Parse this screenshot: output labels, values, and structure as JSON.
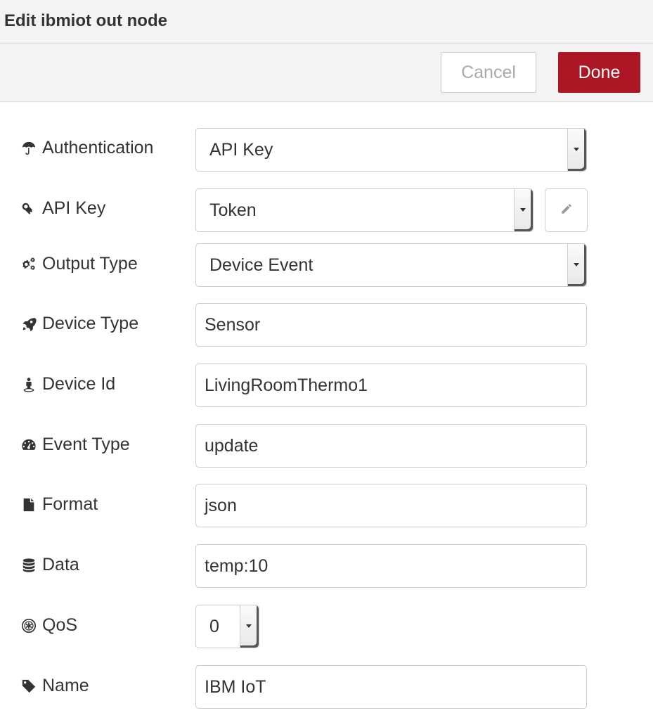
{
  "dialog": {
    "title": "Edit ibmiot out node",
    "cancel_label": "Cancel",
    "done_label": "Done",
    "accent_color": "#ad1625"
  },
  "form": {
    "authentication": {
      "label": "Authentication",
      "value": "API Key",
      "icon": "umbrella-icon"
    },
    "api_key": {
      "label": "API Key",
      "value": "Token",
      "icon": "key-icon",
      "edit_icon": "pencil-icon"
    },
    "output_type": {
      "label": "Output Type",
      "value": "Device Event",
      "icon": "cogs-icon"
    },
    "device_type": {
      "label": "Device Type",
      "value": "Sensor",
      "icon": "rocket-icon"
    },
    "device_id": {
      "label": "Device Id",
      "value": "LivingRoomThermo1",
      "icon": "street-view-icon"
    },
    "event_type": {
      "label": "Event Type",
      "value": "update",
      "icon": "dashboard-icon"
    },
    "format": {
      "label": "Format",
      "value": "json",
      "icon": "file-icon"
    },
    "data": {
      "label": "Data",
      "value": "temp:10",
      "icon": "database-icon"
    },
    "qos": {
      "label": "QoS",
      "value": "0",
      "icon": "qos-icon"
    },
    "name": {
      "label": "Name",
      "value": "IBM IoT",
      "icon": "tag-icon"
    }
  }
}
